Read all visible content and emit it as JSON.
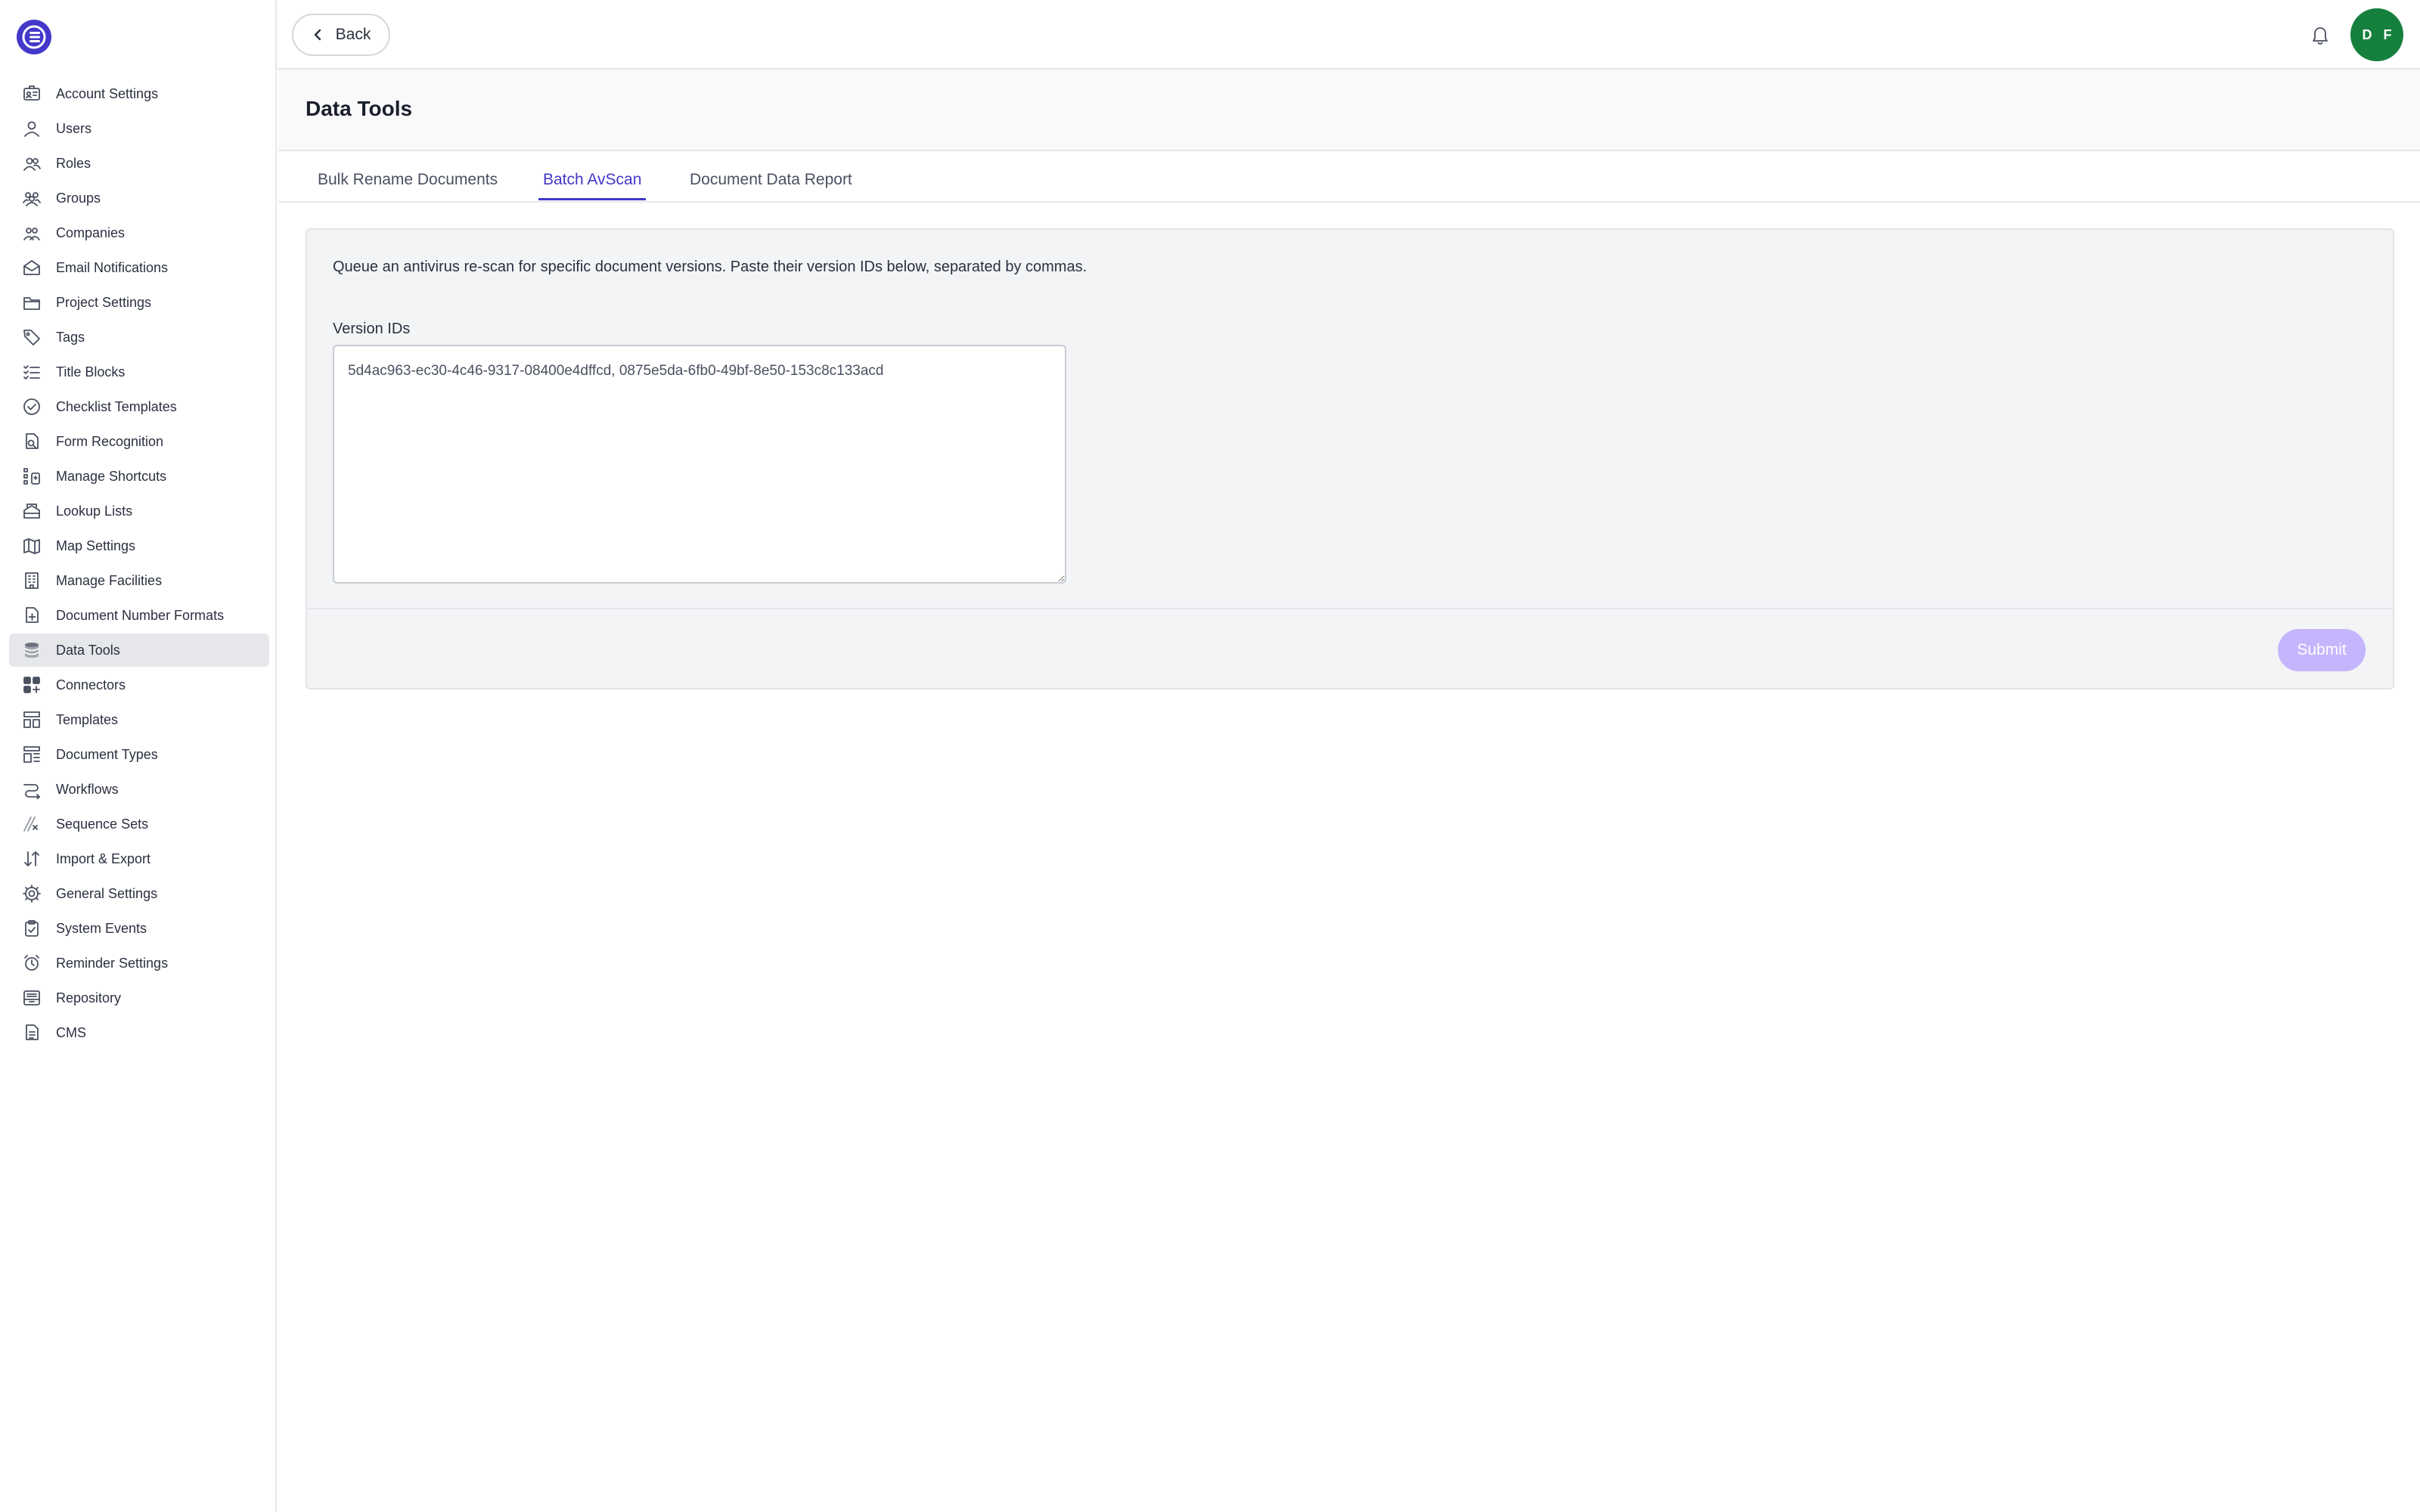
{
  "sidebar": {
    "items": [
      {
        "label": "Account Settings",
        "icon": "id-card-icon"
      },
      {
        "label": "Users",
        "icon": "user-icon"
      },
      {
        "label": "Roles",
        "icon": "users-icon"
      },
      {
        "label": "Groups",
        "icon": "group-icon"
      },
      {
        "label": "Companies",
        "icon": "company-icon"
      },
      {
        "label": "Email Notifications",
        "icon": "mail-icon"
      },
      {
        "label": "Project Settings",
        "icon": "folder-icon"
      },
      {
        "label": "Tags",
        "icon": "tag-icon"
      },
      {
        "label": "Title Blocks",
        "icon": "list-check-icon"
      },
      {
        "label": "Checklist Templates",
        "icon": "check-circle-icon"
      },
      {
        "label": "Form Recognition",
        "icon": "document-search-icon"
      },
      {
        "label": "Manage Shortcuts",
        "icon": "shortcut-icon"
      },
      {
        "label": "Lookup Lists",
        "icon": "stack-icon"
      },
      {
        "label": "Map Settings",
        "icon": "map-icon"
      },
      {
        "label": "Manage Facilities",
        "icon": "building-icon"
      },
      {
        "label": "Document Number Formats",
        "icon": "file-plus-icon"
      },
      {
        "label": "Data Tools",
        "icon": "database-icon",
        "active": true
      },
      {
        "label": "Connectors",
        "icon": "grid-plus-icon"
      },
      {
        "label": "Templates",
        "icon": "template-icon"
      },
      {
        "label": "Document Types",
        "icon": "layout-icon"
      },
      {
        "label": "Workflows",
        "icon": "workflow-icon"
      },
      {
        "label": "Sequence Sets",
        "icon": "sequence-icon"
      },
      {
        "label": "Import & Export",
        "icon": "arrows-updown-icon"
      },
      {
        "label": "General Settings",
        "icon": "gear-icon"
      },
      {
        "label": "System Events",
        "icon": "clipboard-check-icon"
      },
      {
        "label": "Reminder Settings",
        "icon": "alarm-icon"
      },
      {
        "label": "Repository",
        "icon": "repository-icon"
      },
      {
        "label": "CMS",
        "icon": "file-text-icon"
      }
    ]
  },
  "topbar": {
    "back_label": "Back",
    "avatar_initials": "D F"
  },
  "page": {
    "title": "Data Tools"
  },
  "tabs": [
    {
      "label": "Bulk Rename Documents",
      "active": false
    },
    {
      "label": "Batch AvScan",
      "active": true
    },
    {
      "label": "Document Data Report",
      "active": false
    }
  ],
  "form": {
    "description": "Queue an antivirus re-scan for specific document versions. Paste their version IDs below, separated by commas.",
    "field_label": "Version IDs",
    "field_value": "5d4ac963-ec30-4c46-9317-08400e4dffcd, 0875e5da-6fb0-49bf-8e50-153c8c133acd",
    "submit_label": "Submit"
  },
  "colors": {
    "accent": "#4338ca",
    "submit_disabled": "#c4b5fd",
    "avatar": "#15803d"
  }
}
